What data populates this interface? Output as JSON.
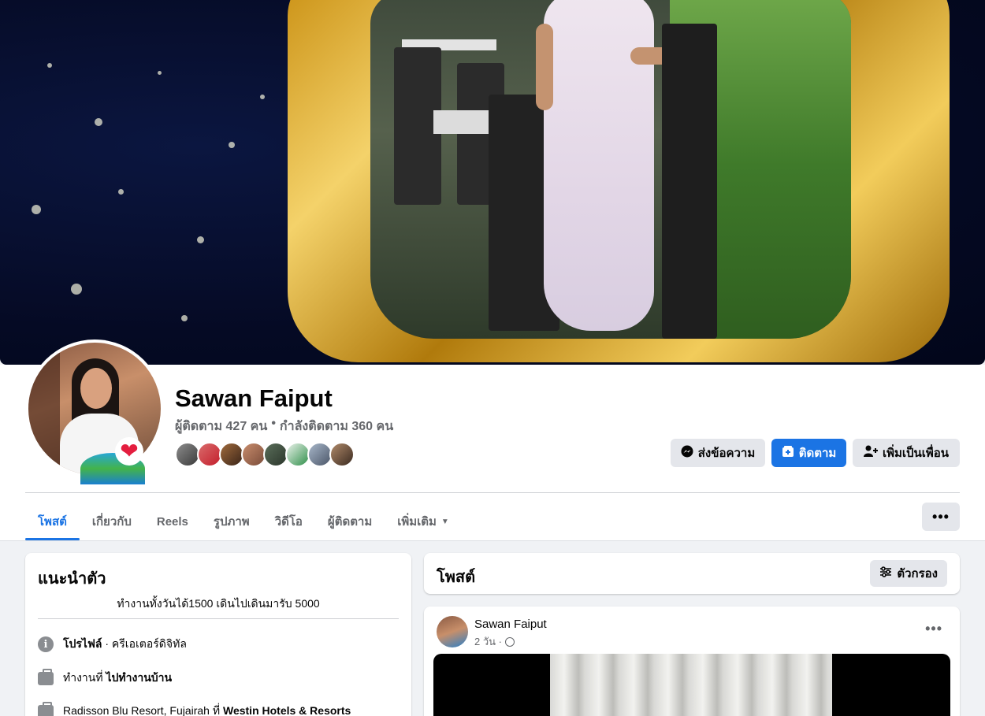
{
  "profile": {
    "name": "Sawan Faiput",
    "followers": "ผู้ติดตาม 427 คน",
    "following": "กำลังติดตาม 360 คน",
    "separator": "•"
  },
  "actions": {
    "message": "ส่งข้อความ",
    "follow": "ติดตาม",
    "add_friend": "เพิ่มเป็นเพื่อน"
  },
  "tabs": [
    {
      "label": "โพสต์"
    },
    {
      "label": "เกี่ยวกับ"
    },
    {
      "label": "Reels"
    },
    {
      "label": "รูปภาพ"
    },
    {
      "label": "วิดีโอ"
    },
    {
      "label": "ผู้ติดตาม"
    },
    {
      "label": "เพิ่มเติม"
    }
  ],
  "more_menu": "•••",
  "intro": {
    "title": "แนะนำตัว",
    "bio": "ทำงานทั้งวันได้1500 เดินไปเดินมารับ 5000",
    "profile_label": "โปรไฟล์",
    "profile_value": " · ครีเอเตอร์ดิจิทัล",
    "work1_prefix": "ทำงานที่ ",
    "work1_value": "ไปทำงานบ้าน",
    "work2_prefix": "Radisson Blu Resort, Fujairah ที่ ",
    "work2_value": "Westin Hotels & Resorts"
  },
  "posts_section": {
    "title": "โพสต์",
    "filter_label": "ตัวกรอง"
  },
  "post": {
    "author": "Sawan Faiput",
    "time": "2 วัน ·",
    "menu": "•••"
  },
  "colors": {
    "accent": "#1b74e4",
    "secondary_text": "#65676b",
    "button_gray": "#e4e6eb",
    "background": "#f0f2f5"
  },
  "icons": [
    "messenger-icon",
    "follow-icon",
    "add-friend-icon",
    "caret-down-icon",
    "info-icon",
    "briefcase-icon",
    "filter-icon",
    "globe-icon",
    "more-icon",
    "heart-badge-icon"
  ]
}
